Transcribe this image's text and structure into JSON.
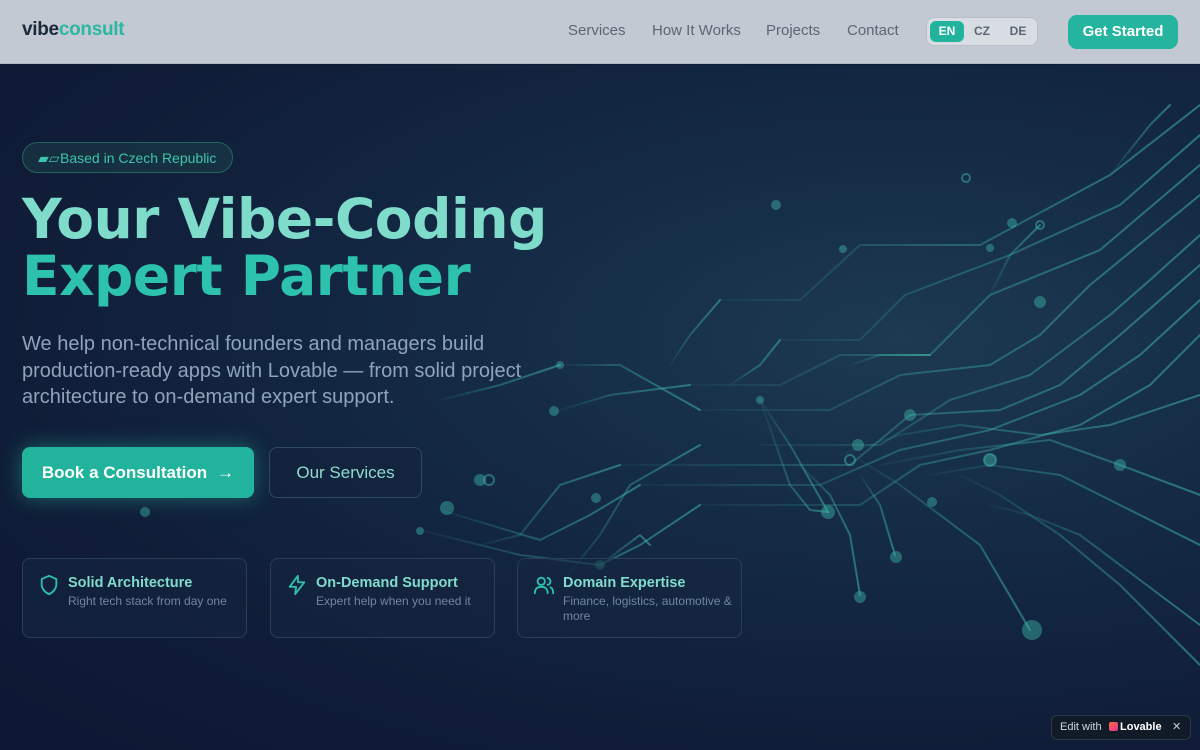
{
  "header": {
    "logo_part1": "vibe",
    "logo_part2": "consult",
    "nav": [
      "Services",
      "How It Works",
      "Projects",
      "Contact"
    ],
    "languages": [
      "EN",
      "CZ",
      "DE"
    ],
    "active_language": "EN",
    "cta_label": "Get Started"
  },
  "hero": {
    "badge_flag": "🇨🇿",
    "badge_label": "Based in Czech Republic",
    "title_line1": "Your Vibe-Coding",
    "title_line2": "Expert Partner",
    "subtitle": "We help non-technical founders and managers build production-ready apps with Lovable — from solid project architecture to on-demand expert support.",
    "primary_button": "Book a Consultation",
    "primary_button_icon": "arrow-right-icon",
    "secondary_button": "Our Services"
  },
  "features": [
    {
      "icon": "shield-icon",
      "title": "Solid Architecture",
      "description": "Right tech stack from day one"
    },
    {
      "icon": "lightning-icon",
      "title": "On-Demand Support",
      "description": "Expert help when you need it"
    },
    {
      "icon": "users-icon",
      "title": "Domain Expertise",
      "description": "Finance, logistics, automotive & more"
    }
  ],
  "lovable_badge": {
    "edit_label": "Edit with",
    "brand": "Lovable",
    "close": "✕"
  },
  "colors": {
    "accent": "#22b39c",
    "accent_light": "#7fdccb",
    "header_bg": "#c3c9d2",
    "hero_bg": "#0f1b33"
  }
}
